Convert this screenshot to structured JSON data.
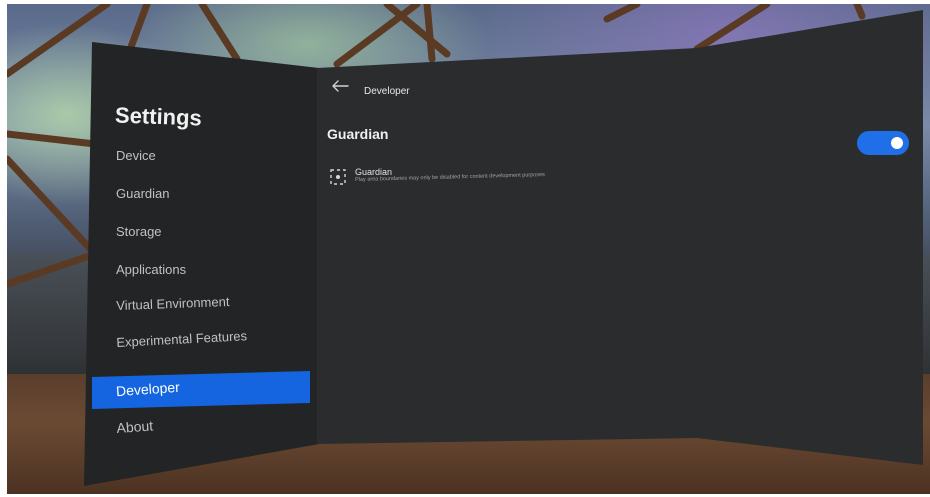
{
  "sidebar": {
    "title": "Settings",
    "items": [
      {
        "label": "Device"
      },
      {
        "label": "Guardian"
      },
      {
        "label": "Storage"
      },
      {
        "label": "Applications"
      },
      {
        "label": "Virtual Environment"
      },
      {
        "label": "Experimental Features"
      },
      {
        "label": "Developer",
        "active": true
      },
      {
        "label": "About"
      }
    ]
  },
  "header": {
    "back_icon": "arrow-left-icon",
    "breadcrumb": "Developer"
  },
  "section": {
    "title": "Guardian",
    "toggle_on": true
  },
  "setting_row": {
    "icon": "guardian-boundary-icon",
    "title": "Guardian",
    "description": "Play area boundaries may only be disabled for content development purposes"
  },
  "colors": {
    "accent": "#1565e0",
    "panel_left": "#232425",
    "panel_right": "#2b2c2e"
  }
}
